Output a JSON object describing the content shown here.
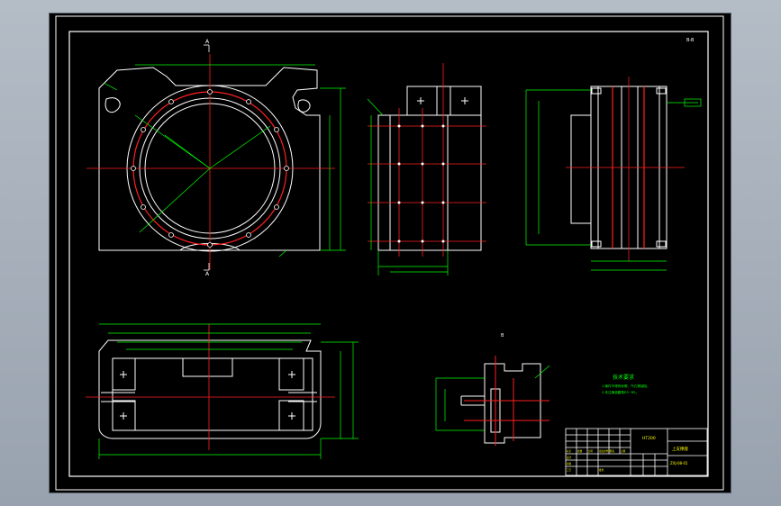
{
  "colors": {
    "background": "#000000",
    "outline": "#ffffff",
    "centerline": "#ff2020",
    "dimension": "#00ff00",
    "accent_text": "#ffff00",
    "title_block": "#ffffff"
  },
  "drawing": {
    "view_labels": {
      "section_mark_a": "A",
      "section_mark_b": "A",
      "detail_label": "B",
      "corner_note": "B-B"
    },
    "technical_requirements": {
      "heading": "技术要求",
      "lines": [
        "1.铸件不得有砂眼、气孔等缺陷。",
        "2.未注铸造圆角R3~R5。"
      ]
    },
    "title_block": {
      "part_name": "上支撑座",
      "drawing_number": "ZXJ-08-01",
      "material": "HT200",
      "labels": [
        "标记",
        "处数",
        "分区",
        "更改文件号",
        "签名",
        "日期",
        "设计",
        "审核",
        "工艺",
        "批准"
      ]
    }
  }
}
